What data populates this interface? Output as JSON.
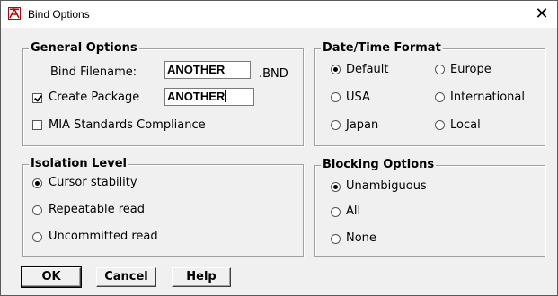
{
  "window": {
    "title": "Bind Options",
    "close_glyph": "✕"
  },
  "general": {
    "legend": "General Options",
    "bind_filename_label": "Bind Filename:",
    "bind_filename_value": "ANOTHER",
    "bnd_suffix": ".BND",
    "create_package_label": "Create Package",
    "create_package_checked": true,
    "package_value": "ANOTHER",
    "mia_label": "MIA Standards Compliance",
    "mia_checked": false
  },
  "datetime": {
    "legend": "Date/Time Format",
    "options": [
      {
        "label": "Default",
        "checked": true
      },
      {
        "label": "Europe",
        "checked": false
      },
      {
        "label": "USA",
        "checked": false
      },
      {
        "label": "International",
        "checked": false
      },
      {
        "label": "Japan",
        "checked": false
      },
      {
        "label": "Local",
        "checked": false
      }
    ]
  },
  "isolation": {
    "legend": "Isolation Level",
    "options": [
      {
        "label": "Cursor stability",
        "checked": true
      },
      {
        "label": "Repeatable read",
        "checked": false
      },
      {
        "label": "Uncommitted read",
        "checked": false
      }
    ]
  },
  "blocking": {
    "legend": "Blocking Options",
    "options": [
      {
        "label": "Unambiguous",
        "checked": true
      },
      {
        "label": "All",
        "checked": false
      },
      {
        "label": "None",
        "checked": false
      }
    ]
  },
  "buttons": {
    "ok": "OK",
    "cancel": "Cancel",
    "help": "Help"
  },
  "icons": {
    "app": "bind-app-icon",
    "close": "close-icon"
  }
}
